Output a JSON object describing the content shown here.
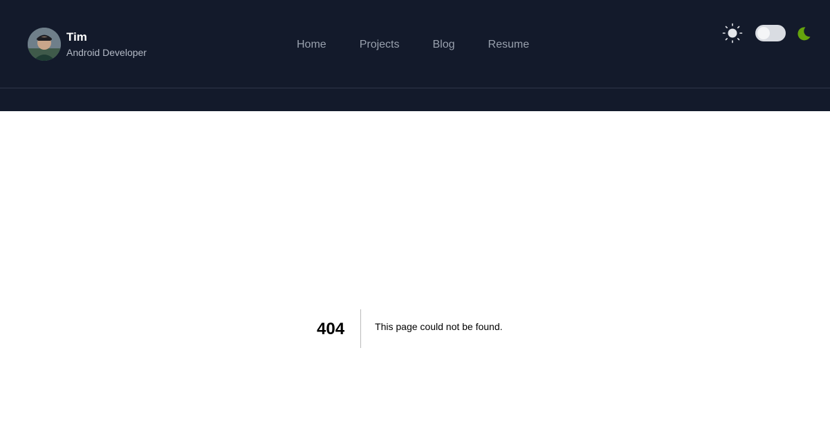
{
  "header": {
    "name": "Tim",
    "role": "Android Developer",
    "avatar_alt": "avatar"
  },
  "nav": {
    "items": [
      {
        "label": "Home"
      },
      {
        "label": "Projects"
      },
      {
        "label": "Blog"
      },
      {
        "label": "Resume"
      }
    ]
  },
  "theme": {
    "sun_icon": "sun-icon",
    "moon_icon": "moon-icon",
    "moon_color": "#65a30d",
    "mode": "light"
  },
  "error": {
    "code": "404",
    "message": "This page could not be found."
  },
  "colors": {
    "header_bg": "#131a2b",
    "page_bg": "#ffffff"
  }
}
